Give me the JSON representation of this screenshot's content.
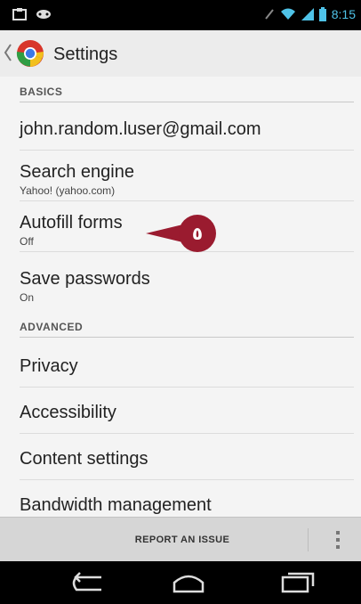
{
  "status_bar": {
    "time": "8:15",
    "icons": [
      "notification-icon",
      "game-controller-icon",
      "signal-off-icon",
      "wifi-icon",
      "cell-signal-icon",
      "battery-icon"
    ]
  },
  "action_bar": {
    "title": "Settings"
  },
  "sections": {
    "basics": "BASICS",
    "advanced": "ADVANCED"
  },
  "items": {
    "account": "john.random.luser@gmail.com",
    "search_engine": {
      "title": "Search engine",
      "summary": "Yahoo! (yahoo.com)"
    },
    "autofill": {
      "title": "Autofill forms",
      "summary": "Off"
    },
    "passwords": {
      "title": "Save passwords",
      "summary": "On"
    },
    "privacy": "Privacy",
    "accessibility": "Accessibility",
    "content_settings": "Content settings",
    "bandwidth": "Bandwidth management"
  },
  "callout": {
    "label": "٥",
    "color": "#9a1b2f"
  },
  "bottom_bar": {
    "report_label": "REPORT AN ISSUE"
  }
}
